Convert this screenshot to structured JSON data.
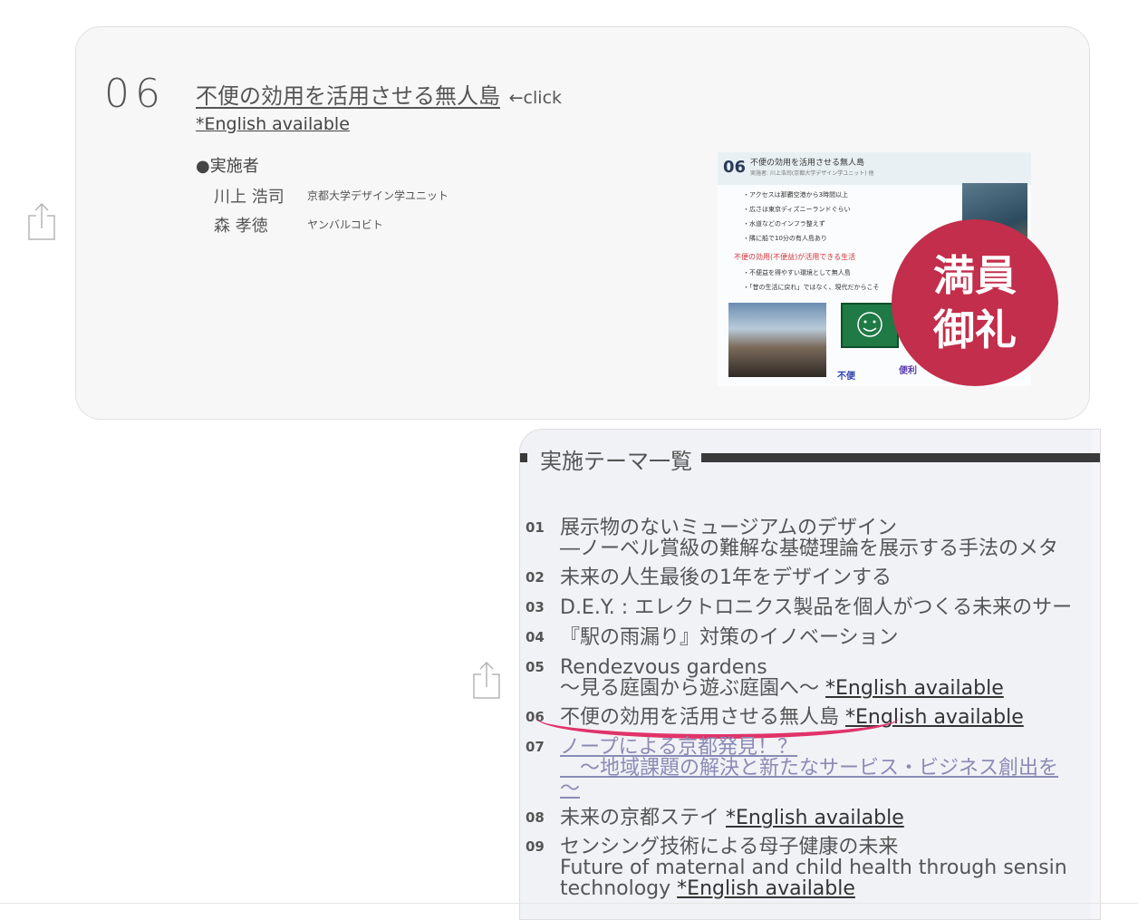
{
  "card1": {
    "number": "06",
    "title": "不便の効用を活用させる無人島",
    "click": "←click",
    "english": "*English available",
    "implementers_label": "●実施者",
    "people": [
      {
        "name": "川上 浩司",
        "affiliation": "京都大学デザイン学ユニット"
      },
      {
        "name": "森 孝徳",
        "affiliation": "ヤンバルコビト"
      }
    ],
    "slide": {
      "number": "06",
      "title": "不便の効用を活用させる無人島",
      "subtitle": "実施者: 川上浩司(京都大学デザイン学ユニット) 他",
      "bullets": [
        "・アクセスは那覇空港から3時間以上",
        "・広さは東京ディズニーランドぐらい",
        "・水道などのインフラ整えず",
        "・隣に船で10分の有人島あり"
      ],
      "red_line": "不便の効用(不便益)が活用できる生活",
      "bullets2": [
        "・不便益を得やすい環境として無人島",
        "・「昔の生活に戻れ」ではなく、現代だからこそ"
      ],
      "word_inconvenient": "不便",
      "word_convenient": "便利"
    },
    "badge": [
      "満員",
      "御礼"
    ],
    "share_icon": "share-icon"
  },
  "card2": {
    "heading": "実施テーマ一覧",
    "items": [
      {
        "no": "01",
        "line1": "展示物のないミュージアムのデザイン",
        "line2": "―ノーベル賞級の難解な基礎理論を展示する手法のメタ"
      },
      {
        "no": "02",
        "line1": "未来の人生最後の1年をデザインする"
      },
      {
        "no": "03",
        "line1": "D.E.Y. : エレクトロニクス製品を個人がつくる未来のサー"
      },
      {
        "no": "04",
        "line1": "『駅の雨漏り』対策のイノベーション"
      },
      {
        "no": "05",
        "line1": "Rendezvous gardens",
        "line2": "～見る庭園から遊ぶ庭園へ～",
        "english": "*English available"
      },
      {
        "no": "06",
        "line1": "不便の効用を活用させる無人島",
        "english": "*English available"
      },
      {
        "no": "07",
        "line1": "ノープによる京都発見！？",
        "line2": "　～地域課題の解決と新たなサービス・ビジネス創出を",
        "line3": "～"
      },
      {
        "no": "08",
        "line1": "未来の京都ステイ",
        "english": "*English available"
      },
      {
        "no": "09",
        "line1": "センシング技術による母子健康の未来",
        "line2": "Future of maternal and child health through sensin",
        "line3": "technology",
        "english": "*English available"
      }
    ]
  },
  "colors": {
    "badge": "#c22e4b",
    "marker": "#e0336a"
  }
}
